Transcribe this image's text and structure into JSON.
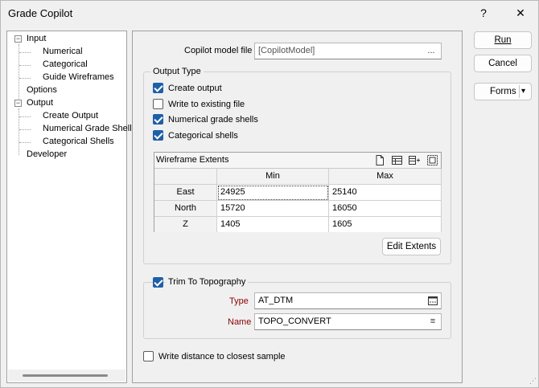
{
  "window": {
    "title": "Grade Copilot"
  },
  "titlebar": {
    "help_glyph": "?",
    "close_glyph": "✕"
  },
  "tree": {
    "input": "Input",
    "numerical": "Numerical",
    "categorical": "Categorical",
    "guide_wireframes": "Guide Wireframes",
    "options": "Options",
    "output": "Output",
    "create_output": "Create Output",
    "numerical_grade_shell": "Numerical Grade Shell",
    "categorical_shells": "Categorical Shells",
    "developer": "Developer",
    "toggle_glyph": "−"
  },
  "main": {
    "copilot_model_label": "Copilot model file",
    "copilot_model_value": "[CopilotModel]",
    "browse_glyph": "...",
    "output_type": {
      "title": "Output Type",
      "create_output": {
        "label": "Create output",
        "checked": true
      },
      "write_existing": {
        "label": "Write to existing file",
        "checked": false
      },
      "numerical_grade_shells": {
        "label": "Numerical grade shells",
        "checked": true
      },
      "categorical_shells": {
        "label": "Categorical shells",
        "checked": true
      }
    },
    "wireframe_extents": {
      "title": "Wireframe Extents",
      "columns": [
        "Min",
        "Max"
      ],
      "rows": [
        {
          "label": "East",
          "min": "24925",
          "max": "25140"
        },
        {
          "label": "North",
          "min": "15720",
          "max": "16050"
        },
        {
          "label": "Z",
          "min": "1405",
          "max": "1605"
        }
      ],
      "edit_button": "Edit Extents"
    },
    "trim": {
      "label": "Trim To Topography",
      "checked": true,
      "type_label": "Type",
      "type_value": "AT_DTM",
      "name_label": "Name",
      "name_value": "TOPO_CONVERT",
      "list_glyph": "≡"
    },
    "write_distance": {
      "label": "Write distance to closest sample",
      "checked": false
    }
  },
  "actions": {
    "run": "Run",
    "cancel": "Cancel",
    "forms": "Forms",
    "dropdown_glyph": "▾"
  },
  "colors": {
    "accent": "#1f5fa8",
    "required_label": "#8b0000"
  }
}
